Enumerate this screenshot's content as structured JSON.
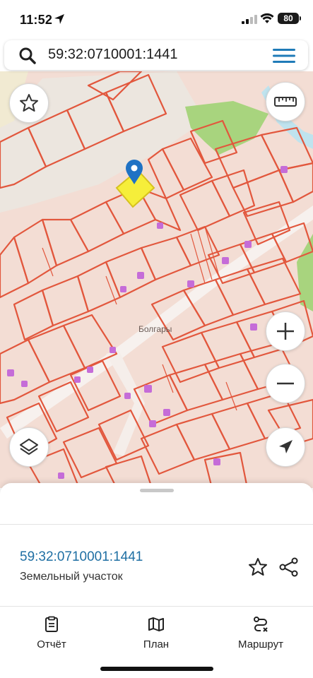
{
  "status_bar": {
    "time": "11:52",
    "battery": "80"
  },
  "search": {
    "query": "59:32:0710001:1441"
  },
  "map": {
    "place_label": "Болгары",
    "highlight_color": "#f6ee3a",
    "parcel_border_color": "#e2573d",
    "green_color": "#a8d47e"
  },
  "map_controls": {
    "favorite": "star-icon",
    "ruler": "ruler-icon",
    "zoom_in": "plus-icon",
    "zoom_out": "minus-icon",
    "layers": "layers-icon",
    "locate": "navigation-arrow-icon"
  },
  "parcel_card": {
    "number": "59:32:0710001:1441",
    "type": "Земельный участок"
  },
  "tabs": [
    {
      "label": "Отчёт",
      "icon": "report-icon"
    },
    {
      "label": "План",
      "icon": "map-icon"
    },
    {
      "label": "Маршрут",
      "icon": "route-icon"
    }
  ]
}
